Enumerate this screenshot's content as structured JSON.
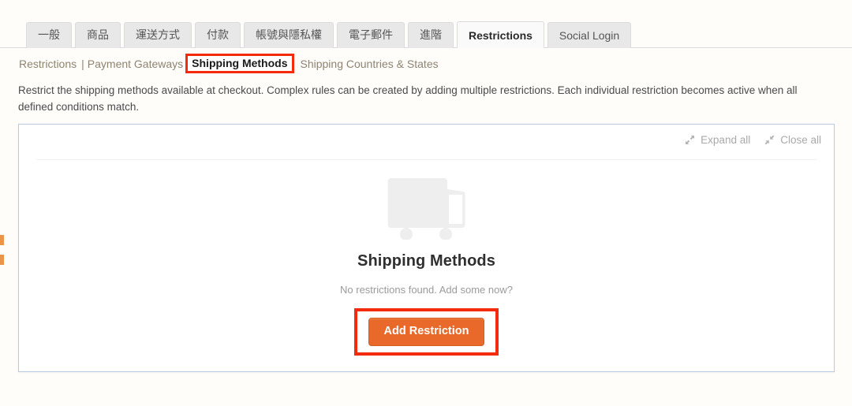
{
  "tabs": [
    {
      "label": "一般",
      "cjk": true,
      "active": false
    },
    {
      "label": "商品",
      "cjk": true,
      "active": false
    },
    {
      "label": "運送方式",
      "cjk": true,
      "active": false
    },
    {
      "label": "付款",
      "cjk": true,
      "active": false
    },
    {
      "label": "帳號與隱私權",
      "cjk": true,
      "active": false
    },
    {
      "label": "電子郵件",
      "cjk": true,
      "active": false
    },
    {
      "label": "進階",
      "cjk": true,
      "active": false
    },
    {
      "label": "Restrictions",
      "cjk": false,
      "active": true
    },
    {
      "label": "Social Login",
      "cjk": false,
      "active": false
    }
  ],
  "subnav": {
    "first": "Restrictions",
    "separator": "|",
    "second": "Payment Gateways",
    "current": "Shipping Methods",
    "last": "Shipping Countries & States"
  },
  "description": "Restrict the shipping methods available at checkout. Complex rules can be created by adding multiple restrictions. Each individual restriction becomes active when all defined conditions match.",
  "panel": {
    "expand_all": "Expand all",
    "close_all": "Close all",
    "empty": {
      "icon": "truck-icon",
      "title": "Shipping Methods",
      "subtitle": "No restrictions found. Add some now?",
      "button": "Add Restriction"
    }
  },
  "colors": {
    "accent_orange": "#e8692a",
    "annotation_red": "#f32a0b",
    "panel_border": "#b9cbe0",
    "link": "#8d8371",
    "page_background": "#fffdfa"
  }
}
